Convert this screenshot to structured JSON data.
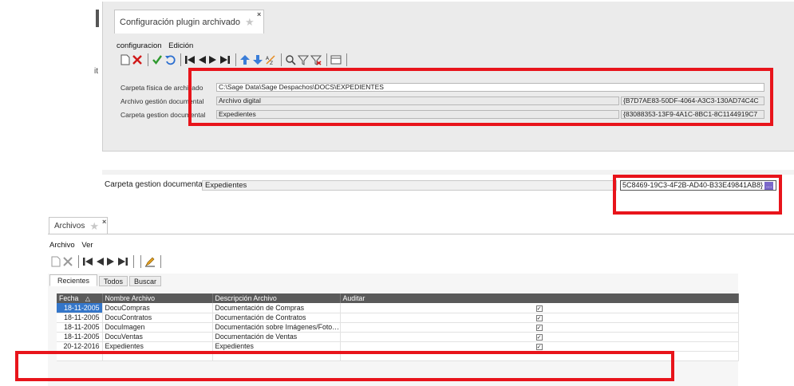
{
  "config_window": {
    "tab_label": "Configuración plugin archivado",
    "close_glyph": "×",
    "menu": [
      "configuracion",
      "Edición"
    ],
    "left_fragment_text": "it",
    "form": {
      "rows": [
        {
          "label": "Carpeta física de archivado",
          "value": "C:\\Sage Data\\Sage Despachos\\DOCS\\EXPEDIENTES",
          "guid": ""
        },
        {
          "label": "Archivo gestión documental",
          "value": "Archivo digital",
          "guid": "{B7D7AE83-50DF-4064-A3C3-130AD74C4C"
        },
        {
          "label": "Carpeta gestion documental",
          "value": "Expedientes",
          "guid": "{83088353-13F9-4A1C-8BC1-8C1144919C7"
        }
      ]
    }
  },
  "middle_fragment": {
    "label": "Carpeta gestion documental",
    "value": "Expedientes",
    "guid": "5C8469-19C3-4F2B-AD40-B33E49841AB8}",
    "button_glyph": "…"
  },
  "archivos_window": {
    "tab_label": "Archivos",
    "close_glyph": "×",
    "menu": [
      "Archivo",
      "Ver"
    ],
    "subtabs": [
      "Recientes",
      "Todos",
      "Buscar"
    ],
    "active_subtab": "Recientes",
    "columns": [
      "Fecha",
      "Nombre Archivo",
      "Descripción Archivo",
      "Auditar"
    ],
    "sort_glyph": "△",
    "rows": [
      {
        "fecha": "18-11-2005",
        "nombre": "DocuCompras",
        "descripcion": "Documentación de Compras",
        "auditar": true
      },
      {
        "fecha": "18-11-2005",
        "nombre": "DocuContratos",
        "descripcion": "Documentación de Contratos",
        "auditar": true
      },
      {
        "fecha": "18-11-2005",
        "nombre": "DocuImagen",
        "descripcion": "Documentación sobre Imágenes/Foto…",
        "auditar": true
      },
      {
        "fecha": "18-11-2005",
        "nombre": "DocuVentas",
        "descripcion": "Documentación de Ventas",
        "auditar": true
      },
      {
        "fecha": "20-12-2016",
        "nombre": "Expedientes",
        "descripcion": "Expedientes",
        "auditar": true
      }
    ]
  },
  "colors": {
    "highlight_red": "#e8141b",
    "header_dark": "#5a5a5a",
    "selected_blue": "#3476c9"
  },
  "icons": {
    "new": "new-doc-icon",
    "delete": "delete-x-icon",
    "accept": "check-icon",
    "undo": "undo-icon",
    "first": "first-record-icon",
    "prev": "prev-record-icon",
    "next": "next-record-icon",
    "last": "last-record-icon",
    "search": "search-icon",
    "filter": "filter-icon",
    "clear_filter": "clear-filter-icon",
    "form": "form-view-icon",
    "star": "favorite-star-icon",
    "edit": "edit-pencil-icon"
  }
}
